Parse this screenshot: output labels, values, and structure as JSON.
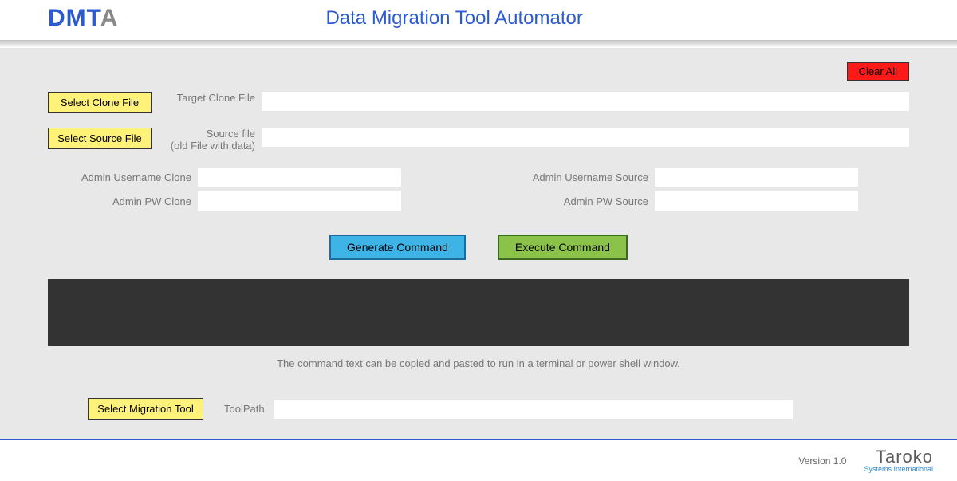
{
  "header": {
    "logo": {
      "d": "D",
      "m": "M",
      "t": "T",
      "a": "A"
    },
    "title": "Data Migration Tool Automator"
  },
  "buttons": {
    "clear_all": "Clear All",
    "select_clone": "Select Clone File",
    "select_source": "Select Source File",
    "generate": "Generate Command",
    "execute": "Execute Command",
    "select_tool": "Select Migration Tool"
  },
  "labels": {
    "target_clone": "Target Clone File",
    "source_file": "Source file",
    "source_file_sub": "(old File with data)",
    "admin_user_clone": "Admin Username Clone",
    "admin_pw_clone": "Admin PW Clone",
    "admin_user_source": "Admin Username Source",
    "admin_pw_source": "Admin PW Source",
    "tool_path": "ToolPath"
  },
  "values": {
    "target_clone_path": "",
    "source_file_path": "",
    "admin_user_clone": "",
    "admin_pw_clone": "",
    "admin_user_source": "",
    "admin_pw_source": "",
    "command_output": "",
    "tool_path": ""
  },
  "hint": "The command text can be copied and pasted to run in a terminal or power shell window.",
  "footer": {
    "version": "Version 1.0",
    "company_name": "Taroko",
    "company_sub": "Systems International"
  }
}
